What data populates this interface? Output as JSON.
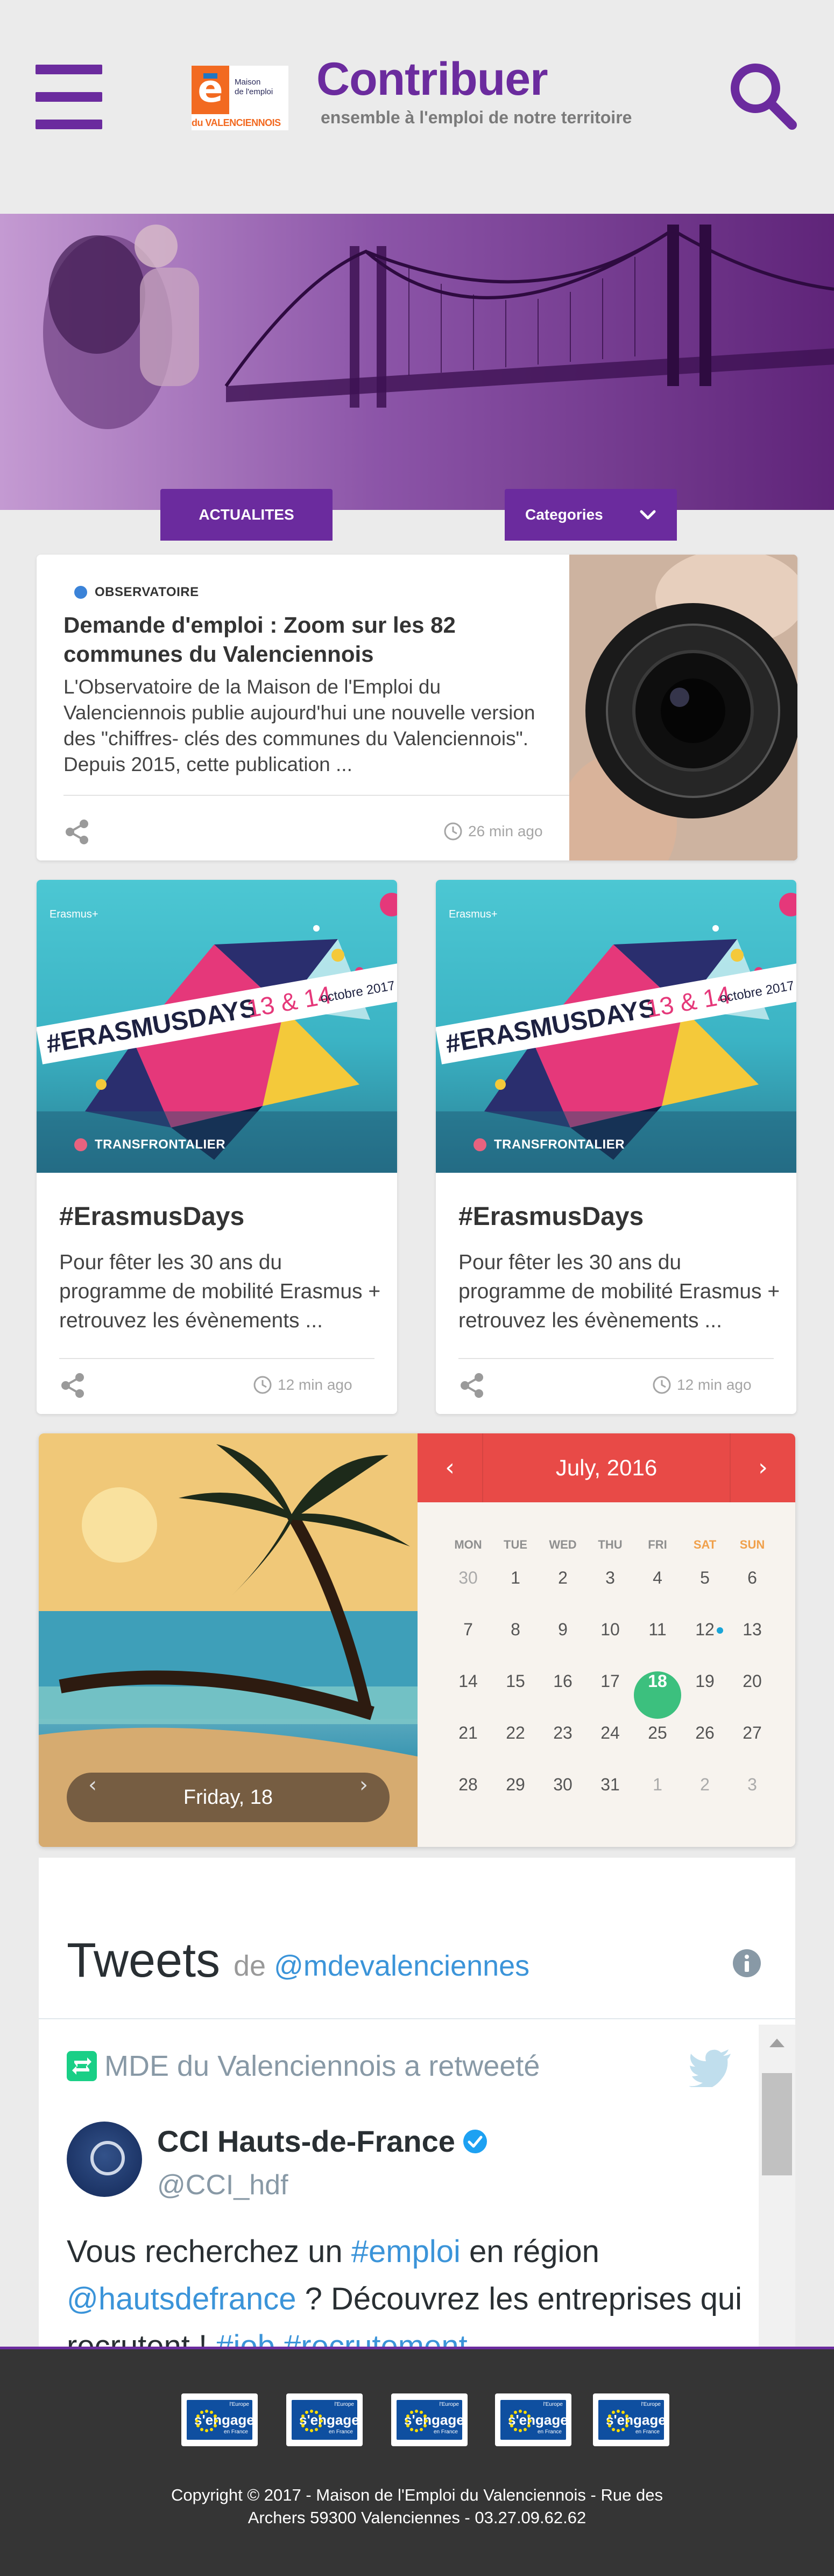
{
  "header": {
    "logo_line1": "Maison",
    "logo_line2": "de l'emploi",
    "logo_line3": "du VALENCIENNOIS",
    "title": "Contribuer",
    "subtitle": "ensemble à l'emploi de notre territoire"
  },
  "tabs": {
    "actualites": "ACTUALITES",
    "categories": "Categories"
  },
  "featured": {
    "tag": "OBSERVATOIRE",
    "tag_color": "#3b83d8",
    "title": "Demande d'emploi : Zoom sur les 82 communes du Valenciennois",
    "excerpt": "L'Observatoire de la Maison de l'Emploi du Valenciennois publie aujourd'hui une nouvelle version des \"chiffres- clés des communes du Valenciennois\". Depuis 2015, cette publication ...",
    "time": "26 min ago"
  },
  "cards": [
    {
      "banner_hashtag": "#ERASMUSDAYS",
      "banner_dates": "13 & 14",
      "banner_month": "octobre 2017",
      "banner_brand": "Erasmus+",
      "tag": "TRANSFRONTALIER",
      "tag_color": "#e8627f",
      "title": "#ErasmusDays",
      "excerpt": "Pour fêter les 30 ans du programme de mobilité Erasmus + retrouvez les évènements ...",
      "time": "12 min ago"
    },
    {
      "banner_hashtag": "#ERASMUSDAYS",
      "banner_dates": "13 & 14",
      "banner_month": "octobre 2017",
      "banner_brand": "Erasmus+",
      "tag": "TRANSFRONTALIER",
      "tag_color": "#e8627f",
      "title": "#ErasmusDays",
      "excerpt": "Pour fêter les 30 ans du programme de mobilité Erasmus + retrouvez les évènements ...",
      "time": "12 min ago"
    }
  ],
  "calendar": {
    "selected_label": "Friday, 18",
    "month": "July, 2016",
    "weekdays": [
      "MON",
      "TUE",
      "WED",
      "THU",
      "FRI",
      "SAT",
      "SUN"
    ],
    "weeks": [
      [
        "30",
        "1",
        "2",
        "3",
        "4",
        "5",
        "6"
      ],
      [
        "7",
        "8",
        "9",
        "10",
        "11",
        "12",
        "13"
      ],
      [
        "14",
        "15",
        "16",
        "17",
        "18",
        "19",
        "20"
      ],
      [
        "21",
        "22",
        "23",
        "24",
        "25",
        "26",
        "27"
      ],
      [
        "28",
        "29",
        "30",
        "31",
        "1",
        "2",
        "3"
      ]
    ],
    "today": "18",
    "event_day": "12",
    "header_color": "#e84a47",
    "today_color": "#3cc07e",
    "weekend_color": "#f0a04b"
  },
  "tweets": {
    "title": "Tweets",
    "by": "de",
    "handle": "@mdevalenciennes",
    "retweet_label": "MDE du Valenciennois a retweeté",
    "author_name": "CCI Hauts-de-France",
    "author_handle": "@CCI_hdf",
    "text_part1": "Vous recherchez un ",
    "text_link1": "#emploi",
    "text_part2": " en région ",
    "text_link2": "@hautsdefrance",
    "text_part3": " ? Découvrez les entreprises qui recrutent ! ",
    "text_link3": "#job #recrutement"
  },
  "footer": {
    "badges": [
      {
        "line1": "l'Europe",
        "line2": "s'engage",
        "line3": "en France"
      },
      {
        "line1": "l'Europe",
        "line2": "s'engage",
        "line3": "en France"
      },
      {
        "line1": "l'Europe",
        "line2": "s'engage",
        "line3": "en France"
      },
      {
        "line1": "l'Europe",
        "line2": "s'engage",
        "line3": "en France"
      },
      {
        "line1": "l'Europe",
        "line2": "s'engage",
        "line3": "en France"
      }
    ],
    "copyright_line1": "Copyright © 2017 - Maison de l'Emploi du Valenciennois - Rue des",
    "copyright_line2": "Archers 59300 Valenciennes - 03.27.09.62.62"
  },
  "colors": {
    "brand": "#6b2b9e",
    "footer_bg": "#353535"
  }
}
